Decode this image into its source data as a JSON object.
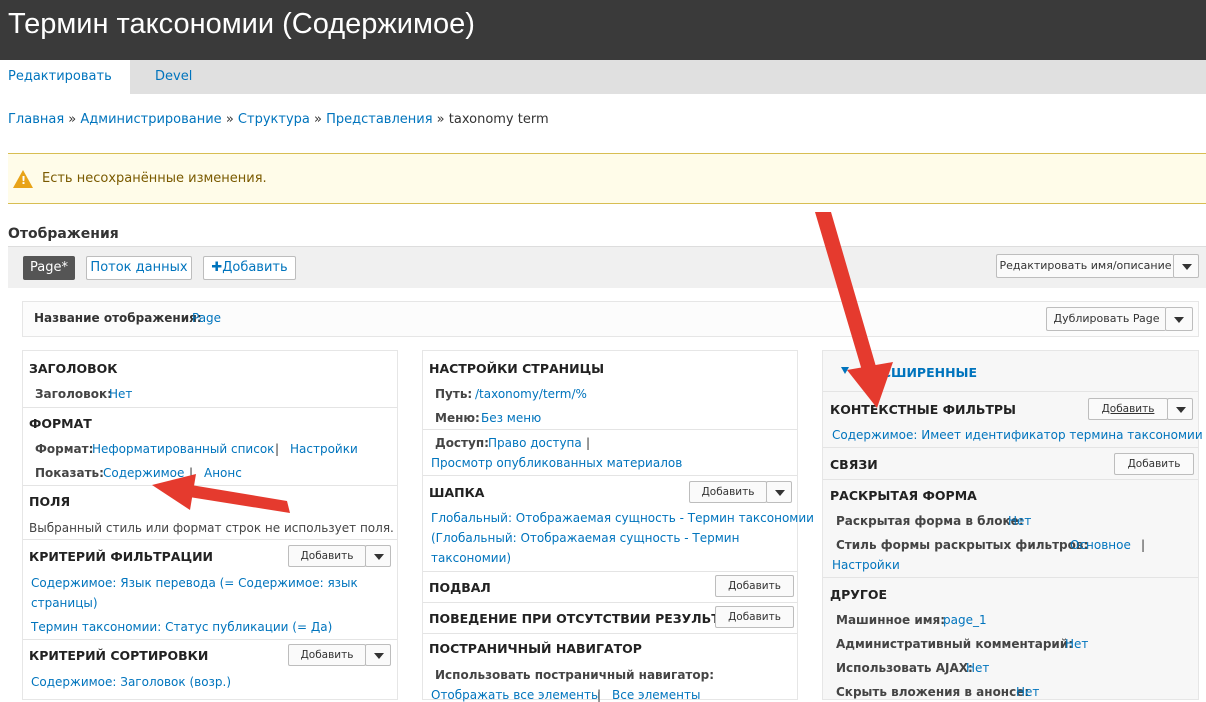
{
  "header": {
    "title": "Термин таксономии (Содержимое)"
  },
  "tabs": [
    {
      "label": "Редактировать"
    },
    {
      "label": "Devel"
    }
  ],
  "breadcrumb": {
    "items": [
      "Главная",
      "Администрирование",
      "Структура",
      "Представления"
    ],
    "current": "taxonomy term",
    "separator": "»"
  },
  "warning": {
    "icon": "warning-icon",
    "text": "Есть несохранённые изменения."
  },
  "displays": {
    "title": "Отображения",
    "page_label": "Page*",
    "flow_label": "Поток данных",
    "add_label": "Добавить",
    "add_plus": "✚",
    "edit_name_label": "Редактировать имя/описание"
  },
  "display_name": {
    "label": "Название отображения:",
    "value": "Page",
    "duplicate_label": "Дублировать Page"
  },
  "col1": {
    "header_title": "ЗАГОЛОВОК",
    "header_label": "Заголовок:",
    "header_value": "Нет",
    "format_title": "ФОРМАТ",
    "format_label": "Формат:",
    "format_value": "Неформатированный список",
    "format_settings": "Настройки",
    "show_label": "Показать:",
    "show_value": "Содержимое",
    "show_teaser": "Анонс",
    "fields_title": "ПОЛЯ",
    "fields_text": "Выбранный стиль или формат строк не использует поля.",
    "filter_title": "КРИТЕРИЙ ФИЛЬТРАЦИИ",
    "filter_add": "Добавить",
    "filter_1_line1": "Содержимое: Язык перевода (= Содержимое: язык",
    "filter_1_line2": "страницы)",
    "filter_2": "Термин таксономии: Статус публикации (= Да)",
    "sort_title": "КРИТЕРИЙ СОРТИРОВКИ",
    "sort_add": "Добавить",
    "sort_1": "Содержимое: Заголовок (возр.)"
  },
  "col2": {
    "page_settings_title": "НАСТРОЙКИ СТРАНИЦЫ",
    "path_label": "Путь:",
    "path_value": "/taxonomy/term/%",
    "menu_label": "Меню:",
    "menu_value": "Без меню",
    "access_label": "Доступ:",
    "access_value": "Право доступа",
    "access_detail": "Просмотр опубликованных материалов",
    "header_title": "ШАПКА",
    "header_add": "Добавить",
    "header_item_line1": "Глобальный: Отображаемая сущность - Термин таксономии",
    "header_item_line2": "(Глобальный: Отображаемая сущность - Термин",
    "header_item_line3": "таксономии)",
    "footer_title": "ПОДВАЛ",
    "footer_add": "Добавить",
    "empty_title": "ПОВЕДЕНИЕ ПРИ ОТСУТСТВИИ РЕЗУЛЬТАТОВ",
    "empty_add": "Добавить",
    "pager_title": "ПОСТРАНИЧНЫЙ НАВИГАТОР",
    "pager_label": "Использовать постраничный навигатор:",
    "pager_value": "Отображать все элементы",
    "pager_extra": "Все элементы"
  },
  "col3": {
    "advanced_title": "РАСШИРЕННЫЕ",
    "context_title": "КОНТЕКСТНЫЕ ФИЛЬТРЫ",
    "context_add": "Добавить",
    "context_item": "Содержимое: Имеет идентификатор термина таксономии",
    "relations_title": "СВЯЗИ",
    "relations_add": "Добавить",
    "exposed_title": "РАСКРЫТАЯ ФОРМА",
    "exposed_block_label": "Раскрытая форма в блоке:",
    "exposed_block_value": "Нет",
    "exposed_style_label": "Стиль формы раскрытых фильтров:",
    "exposed_style_value": "Основное",
    "exposed_style_settings": "Настройки",
    "other_title": "ДРУГОЕ",
    "machine_label": "Машинное имя:",
    "machine_value": "page_1",
    "comment_label": "Административный комментарий:",
    "comment_value": "Нет",
    "ajax_label": "Использовать AJAX:",
    "ajax_value": "Нет",
    "hide_label": "Скрыть вложения в анонсе:",
    "hide_value": "Нет"
  },
  "colors": {
    "link": "#0074bd",
    "header_bg": "#3a3a3a",
    "arrow": "#e53a2e",
    "warning_border": "#d8be52"
  }
}
